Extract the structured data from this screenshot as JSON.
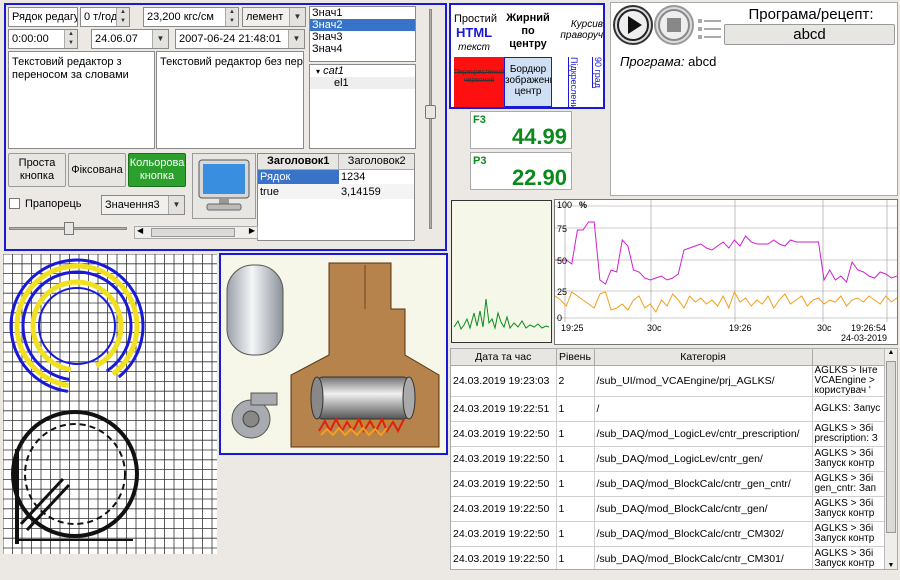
{
  "form": {
    "line_edit": "Рядок редагу",
    "spin1": "0 т/год",
    "spin2": "23,200 кгс/см",
    "combo1": "лемент",
    "time_edit": "0:00:00",
    "date_edit": "24.06.07",
    "datetime_edit": "2007-06-24 21:48:01",
    "text_wrap": "Текстовий редактор з переносом за словами",
    "text_nowrap": "Текстовий редактор без пере",
    "list_items": [
      "Знач1",
      "Знач2",
      "Знач3",
      "Знач4"
    ],
    "list_selected": 1,
    "tree": {
      "parent": "cat1",
      "child": "el1"
    },
    "btn_simple": "Проста кнопка",
    "btn_fixed": "Фіксована",
    "btn_color": "Кольорова кнопка",
    "checkbox_label": "Прапорець",
    "combo2": "Значення3",
    "table_headers": [
      "Заголовок1",
      "Заголовок2"
    ],
    "table_rows": [
      [
        "Рядок",
        "1234"
      ],
      [
        "true",
        "3,14159"
      ]
    ]
  },
  "text_styles": {
    "plain": "Простий",
    "html_1": "HTML",
    "html_2": "текст",
    "bold": "Жирний по центру",
    "italic": "Курсив праворуч",
    "strike": "Перекреслений червоний",
    "border": "Бордюр зображення центр",
    "rot90": "90 град",
    "underline": "Підкреслений"
  },
  "values": {
    "f3_label": "F3",
    "f3_value": "44.99",
    "p3_label": "P3",
    "p3_value": "22.90"
  },
  "program": {
    "title": "Програма/рецепт:",
    "name": "abcd",
    "info_label": "Програма:",
    "info_value": "abcd"
  },
  "trend": {
    "y_ticks": [
      "100",
      "75",
      "50",
      "25",
      "0"
    ],
    "y_unit": "%",
    "x_ticks": [
      "19:25",
      "30c",
      "19:26",
      "30c",
      "19:26:54"
    ],
    "date": "24-03-2019"
  },
  "log": {
    "headers": [
      "Дата та час",
      "Рівень",
      "Категорія",
      ""
    ],
    "rows": [
      [
        "24.03.2019 19:23:03",
        "2",
        "/sub_UI/mod_VCAEngine/prj_AGLKS/",
        "AGLKS > Інте\nVCAEngine >\nкористувач '"
      ],
      [
        "24.03.2019 19:22:51",
        "1",
        "/",
        "AGLKS: Запус"
      ],
      [
        "24.03.2019 19:22:50",
        "1",
        "/sub_DAQ/mod_LogicLev/cntr_prescription/",
        "AGLKS > Збі\nprescription: З"
      ],
      [
        "24.03.2019 19:22:50",
        "1",
        "/sub_DAQ/mod_LogicLev/cntr_gen/",
        "AGLKS > Збі\nЗапуск контр"
      ],
      [
        "24.03.2019 19:22:50",
        "1",
        "/sub_DAQ/mod_BlockCalc/cntr_gen_cntr/",
        "AGLKS > Збі\ngen_cntr: Зап"
      ],
      [
        "24.03.2019 19:22:50",
        "1",
        "/sub_DAQ/mod_BlockCalc/cntr_gen/",
        "AGLKS > Збі\nЗапуск контр"
      ],
      [
        "24.03.2019 19:22:50",
        "1",
        "/sub_DAQ/mod_BlockCalc/cntr_CM302/",
        "AGLKS > Збі\nЗапуск контр"
      ],
      [
        "24.03.2019 19:22:50",
        "1",
        "/sub_DAQ/mod_BlockCalc/cntr_CM301/",
        "AGLKS > Збі\nЗапуск контр"
      ]
    ]
  },
  "colors": {
    "accent": "#1a1ad6",
    "green": "#0a8a1a",
    "magenta": "#d020d0",
    "orange": "#f0a020"
  }
}
